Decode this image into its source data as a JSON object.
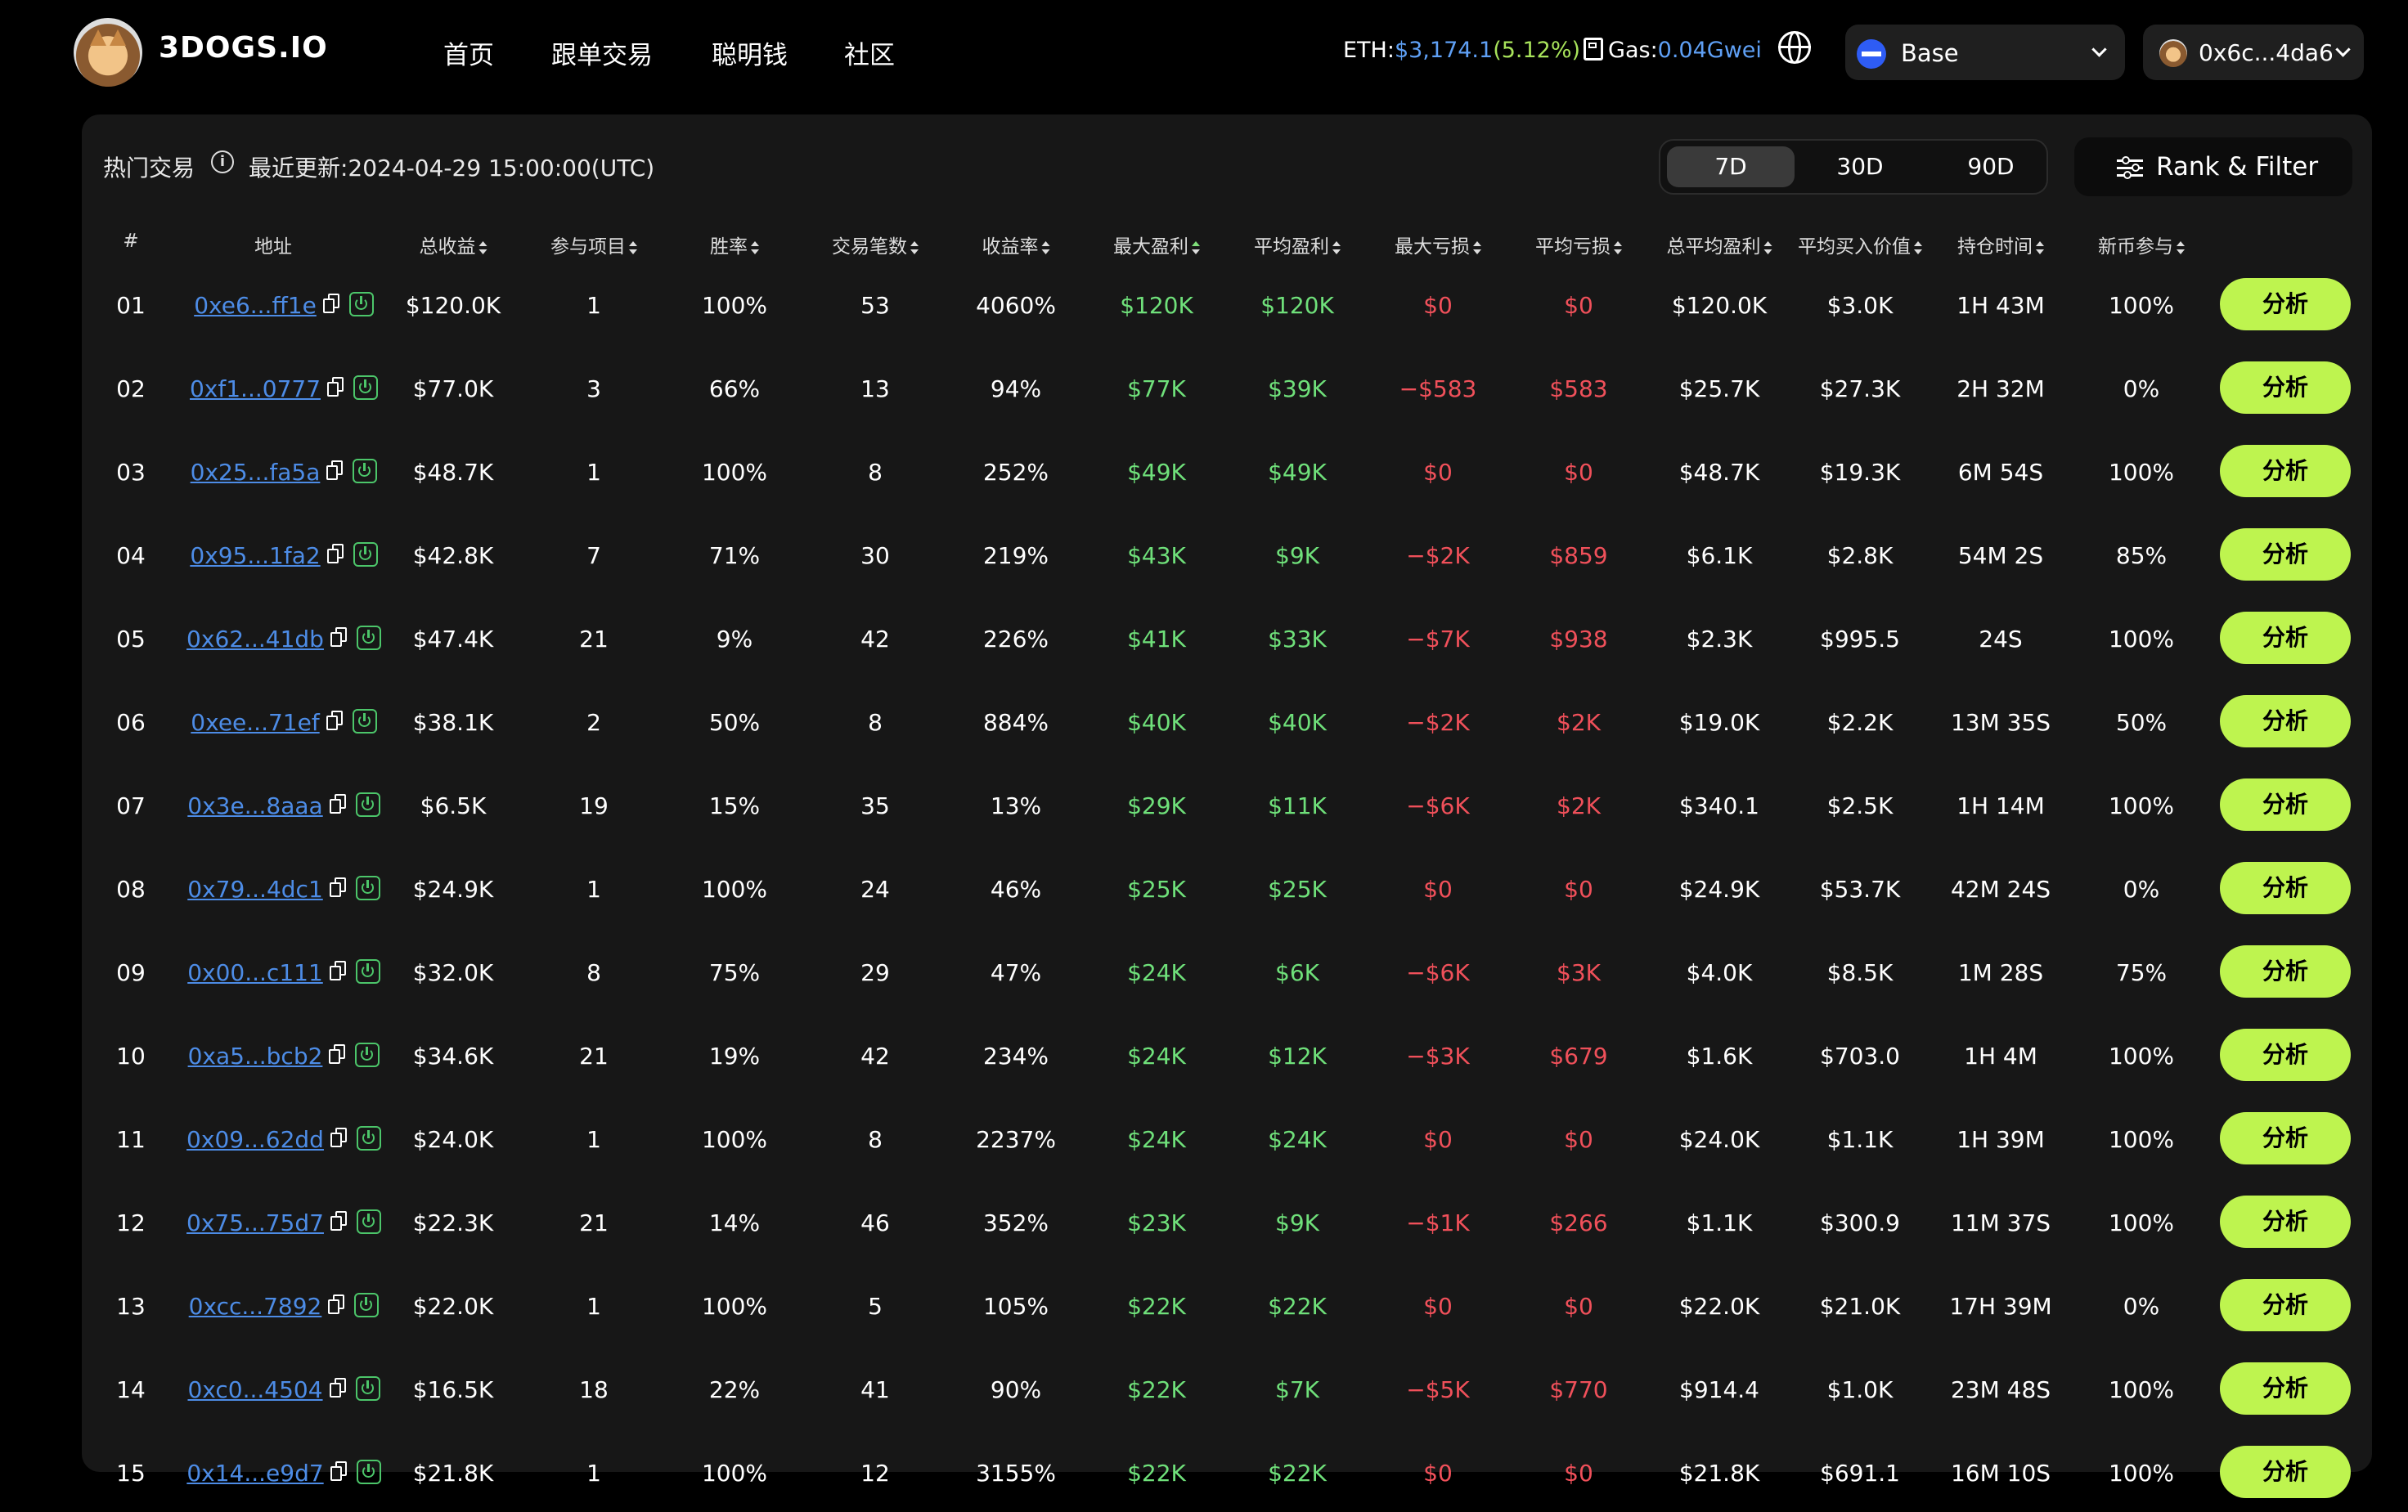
{
  "brand": {
    "name": "3DOGS.IO"
  },
  "nav": [
    {
      "label": "首页"
    },
    {
      "label": "跟单交易"
    },
    {
      "label": "聪明钱"
    },
    {
      "label": "社区"
    }
  ],
  "header": {
    "eth_label": "ETH:",
    "eth_price": "$3,174.1",
    "eth_change": "(5.12%)",
    "gas_label": "Gas:",
    "gas_value": "0.04Gwei",
    "chain": "Base",
    "wallet": "0x6c...4da6"
  },
  "panel": {
    "title": "热门交易",
    "updated": "最近更新:2024-04-29 15:00:00(UTC)",
    "ranges": [
      "7D",
      "30D",
      "90D"
    ],
    "active_range": "7D",
    "rank_filter_label": "Rank & Filter",
    "analyze_label": "分析"
  },
  "columns": [
    "#",
    "地址",
    "总收益",
    "参与项目",
    "胜率",
    "交易笔数",
    "收益率",
    "最大盈利",
    "平均盈利",
    "最大亏损",
    "平均亏损",
    "总平均盈利",
    "平均买入价值",
    "持仓时间",
    "新币参与"
  ],
  "rows": [
    {
      "rank": "01",
      "addr": "0xe6...ff1e",
      "profit": "$120.0K",
      "projects": "1",
      "winrate": "100%",
      "trades": "53",
      "roi": "4060%",
      "max_win": "$120K",
      "avg_win": "$120K",
      "max_loss": "$0",
      "avg_loss": "$0",
      "total_avg": "$120.0K",
      "avg_buy": "$3.0K",
      "hold": "1H 43M",
      "new_coin": "100%"
    },
    {
      "rank": "02",
      "addr": "0xf1...0777",
      "profit": "$77.0K",
      "projects": "3",
      "winrate": "66%",
      "trades": "13",
      "roi": "94%",
      "max_win": "$77K",
      "avg_win": "$39K",
      "max_loss": "−$583",
      "avg_loss": "$583",
      "total_avg": "$25.7K",
      "avg_buy": "$27.3K",
      "hold": "2H 32M",
      "new_coin": "0%"
    },
    {
      "rank": "03",
      "addr": "0x25...fa5a",
      "profit": "$48.7K",
      "projects": "1",
      "winrate": "100%",
      "trades": "8",
      "roi": "252%",
      "max_win": "$49K",
      "avg_win": "$49K",
      "max_loss": "$0",
      "avg_loss": "$0",
      "total_avg": "$48.7K",
      "avg_buy": "$19.3K",
      "hold": "6M 54S",
      "new_coin": "100%"
    },
    {
      "rank": "04",
      "addr": "0x95...1fa2",
      "profit": "$42.8K",
      "projects": "7",
      "winrate": "71%",
      "trades": "30",
      "roi": "219%",
      "max_win": "$43K",
      "avg_win": "$9K",
      "max_loss": "−$2K",
      "avg_loss": "$859",
      "total_avg": "$6.1K",
      "avg_buy": "$2.8K",
      "hold": "54M 2S",
      "new_coin": "85%"
    },
    {
      "rank": "05",
      "addr": "0x62...41db",
      "profit": "$47.4K",
      "projects": "21",
      "winrate": "9%",
      "trades": "42",
      "roi": "226%",
      "max_win": "$41K",
      "avg_win": "$33K",
      "max_loss": "−$7K",
      "avg_loss": "$938",
      "total_avg": "$2.3K",
      "avg_buy": "$995.5",
      "hold": "24S",
      "new_coin": "100%"
    },
    {
      "rank": "06",
      "addr": "0xee...71ef",
      "profit": "$38.1K",
      "projects": "2",
      "winrate": "50%",
      "trades": "8",
      "roi": "884%",
      "max_win": "$40K",
      "avg_win": "$40K",
      "max_loss": "−$2K",
      "avg_loss": "$2K",
      "total_avg": "$19.0K",
      "avg_buy": "$2.2K",
      "hold": "13M 35S",
      "new_coin": "50%"
    },
    {
      "rank": "07",
      "addr": "0x3e...8aaa",
      "profit": "$6.5K",
      "projects": "19",
      "winrate": "15%",
      "trades": "35",
      "roi": "13%",
      "max_win": "$29K",
      "avg_win": "$11K",
      "max_loss": "−$6K",
      "avg_loss": "$2K",
      "total_avg": "$340.1",
      "avg_buy": "$2.5K",
      "hold": "1H 14M",
      "new_coin": "100%"
    },
    {
      "rank": "08",
      "addr": "0x79...4dc1",
      "profit": "$24.9K",
      "projects": "1",
      "winrate": "100%",
      "trades": "24",
      "roi": "46%",
      "max_win": "$25K",
      "avg_win": "$25K",
      "max_loss": "$0",
      "avg_loss": "$0",
      "total_avg": "$24.9K",
      "avg_buy": "$53.7K",
      "hold": "42M 24S",
      "new_coin": "0%"
    },
    {
      "rank": "09",
      "addr": "0x00...c111",
      "profit": "$32.0K",
      "projects": "8",
      "winrate": "75%",
      "trades": "29",
      "roi": "47%",
      "max_win": "$24K",
      "avg_win": "$6K",
      "max_loss": "−$6K",
      "avg_loss": "$3K",
      "total_avg": "$4.0K",
      "avg_buy": "$8.5K",
      "hold": "1M 28S",
      "new_coin": "75%"
    },
    {
      "rank": "10",
      "addr": "0xa5...bcb2",
      "profit": "$34.6K",
      "projects": "21",
      "winrate": "19%",
      "trades": "42",
      "roi": "234%",
      "max_win": "$24K",
      "avg_win": "$12K",
      "max_loss": "−$3K",
      "avg_loss": "$679",
      "total_avg": "$1.6K",
      "avg_buy": "$703.0",
      "hold": "1H 4M",
      "new_coin": "100%"
    },
    {
      "rank": "11",
      "addr": "0x09...62dd",
      "profit": "$24.0K",
      "projects": "1",
      "winrate": "100%",
      "trades": "8",
      "roi": "2237%",
      "max_win": "$24K",
      "avg_win": "$24K",
      "max_loss": "$0",
      "avg_loss": "$0",
      "total_avg": "$24.0K",
      "avg_buy": "$1.1K",
      "hold": "1H 39M",
      "new_coin": "100%"
    },
    {
      "rank": "12",
      "addr": "0x75...75d7",
      "profit": "$22.3K",
      "projects": "21",
      "winrate": "14%",
      "trades": "46",
      "roi": "352%",
      "max_win": "$23K",
      "avg_win": "$9K",
      "max_loss": "−$1K",
      "avg_loss": "$266",
      "total_avg": "$1.1K",
      "avg_buy": "$300.9",
      "hold": "11M 37S",
      "new_coin": "100%"
    },
    {
      "rank": "13",
      "addr": "0xcc...7892",
      "profit": "$22.0K",
      "projects": "1",
      "winrate": "100%",
      "trades": "5",
      "roi": "105%",
      "max_win": "$22K",
      "avg_win": "$22K",
      "max_loss": "$0",
      "avg_loss": "$0",
      "total_avg": "$22.0K",
      "avg_buy": "$21.0K",
      "hold": "17H 39M",
      "new_coin": "0%"
    },
    {
      "rank": "14",
      "addr": "0xc0...4504",
      "profit": "$16.5K",
      "projects": "18",
      "winrate": "22%",
      "trades": "41",
      "roi": "90%",
      "max_win": "$22K",
      "avg_win": "$7K",
      "max_loss": "−$5K",
      "avg_loss": "$770",
      "total_avg": "$914.4",
      "avg_buy": "$1.0K",
      "hold": "23M 48S",
      "new_coin": "100%"
    },
    {
      "rank": "15",
      "addr": "0x14...e9d7",
      "profit": "$21.8K",
      "projects": "1",
      "winrate": "100%",
      "trades": "12",
      "roi": "3155%",
      "max_win": "$22K",
      "avg_win": "$22K",
      "max_loss": "$0",
      "avg_loss": "$0",
      "total_avg": "$21.8K",
      "avg_buy": "$691.1",
      "hold": "16M 10S",
      "new_coin": "100%"
    }
  ],
  "colors": {
    "accent": "#bef44f",
    "gain": "#6fe07a",
    "loss": "#f0505a",
    "link": "#4d8ce6",
    "eth_price": "#5fa0f5",
    "eth_change": "#a8e35b"
  },
  "icons": [
    "copy-icon",
    "power-icon",
    "info-icon",
    "globe-icon",
    "gas-pump-icon",
    "filter-icon",
    "chevron-down-icon"
  ]
}
